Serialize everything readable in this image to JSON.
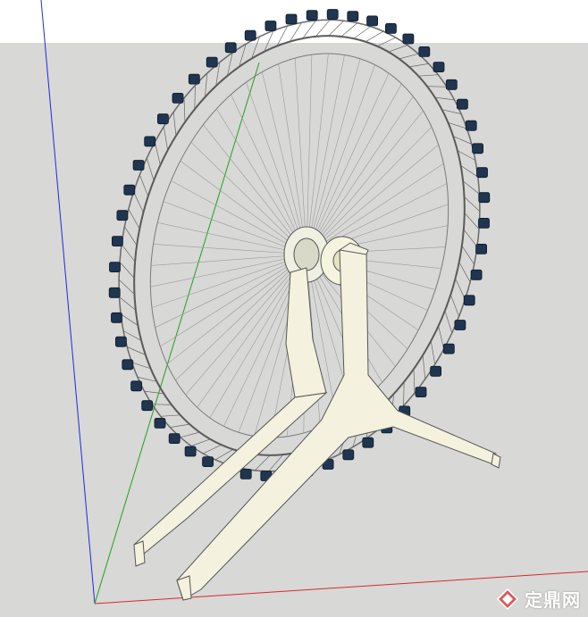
{
  "scene": {
    "sky_color": "#ffffff",
    "ground_color": "#d8d8d6",
    "axis_colors": {
      "blue": "#1f2bd8",
      "green": "#1da21d",
      "red": "#d62a2a"
    },
    "structure_color": "#f4f1de",
    "cabin_color": "#1f3550",
    "wheel_color": "#5a5a5a"
  },
  "watermark": {
    "text": "定鼎网",
    "logo_icon": "diamond-logo-icon"
  }
}
